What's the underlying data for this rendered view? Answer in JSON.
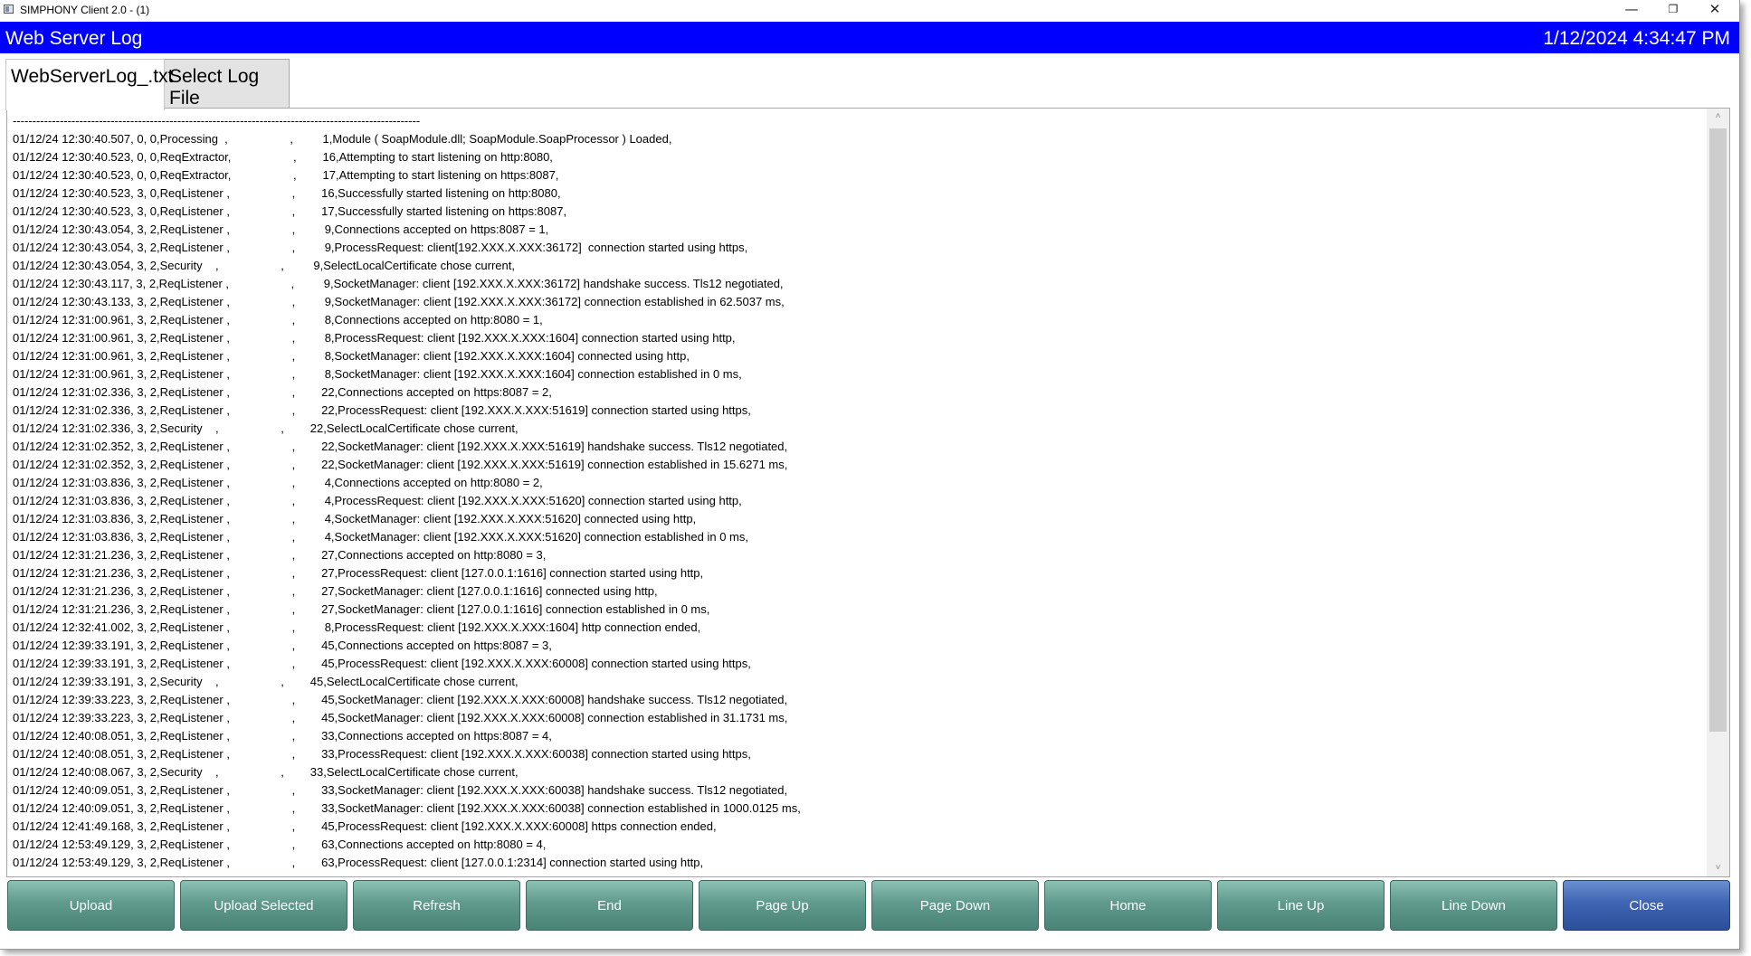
{
  "window": {
    "title": "SIMPHONY Client 2.0 - (1)",
    "controls": {
      "minimize": "—",
      "restore": "❐",
      "close": "✕"
    }
  },
  "header": {
    "title": "Web Server Log",
    "datetime": "1/12/2024 4:34:47 PM",
    "background": "#0000ff"
  },
  "tabs": [
    {
      "label": "WebServerLog_.txt",
      "active": true
    },
    {
      "label": "Select Log File",
      "active": false
    }
  ],
  "log": {
    "lines": [
      "--------------------------------------------------------------------------------------------------------",
      "01/12/24 12:30:40.507, 0, 0,Processing  ,                   ,         1,Module ( SoapModule.dll; SoapModule.SoapProcessor ) Loaded,",
      "01/12/24 12:30:40.523, 0, 0,ReqExtractor,                   ,        16,Attempting to start listening on http:8080,",
      "01/12/24 12:30:40.523, 0, 0,ReqExtractor,                   ,        17,Attempting to start listening on https:8087,",
      "01/12/24 12:30:40.523, 3, 0,ReqListener ,                   ,        16,Successfully started listening on http:8080,",
      "01/12/24 12:30:40.523, 3, 0,ReqListener ,                   ,        17,Successfully started listening on https:8087,",
      "01/12/24 12:30:43.054, 3, 2,ReqListener ,                   ,         9,Connections accepted on https:8087 = 1,",
      "01/12/24 12:30:43.054, 3, 2,ReqListener ,                   ,         9,ProcessRequest: client[192.XXX.X.XXX:36172]  connection started using https,",
      "01/12/24 12:30:43.054, 3, 2,Security    ,                   ,         9,SelectLocalCertificate chose current,",
      "01/12/24 12:30:43.117, 3, 2,ReqListener ,                   ,         9,SocketManager: client [192.XXX.X.XXX:36172] handshake success. Tls12 negotiated,",
      "01/12/24 12:30:43.133, 3, 2,ReqListener ,                   ,         9,SocketManager: client [192.XXX.X.XXX:36172] connection established in 62.5037 ms,",
      "01/12/24 12:31:00.961, 3, 2,ReqListener ,                   ,         8,Connections accepted on http:8080 = 1,",
      "01/12/24 12:31:00.961, 3, 2,ReqListener ,                   ,         8,ProcessRequest: client [192.XXX.X.XXX:1604] connection started using http,",
      "01/12/24 12:31:00.961, 3, 2,ReqListener ,                   ,         8,SocketManager: client [192.XXX.X.XXX:1604] connected using http,",
      "01/12/24 12:31:00.961, 3, 2,ReqListener ,                   ,         8,SocketManager: client [192.XXX.X.XXX:1604] connection established in 0 ms,",
      "01/12/24 12:31:02.336, 3, 2,ReqListener ,                   ,        22,Connections accepted on https:8087 = 2,",
      "01/12/24 12:31:02.336, 3, 2,ReqListener ,                   ,        22,ProcessRequest: client [192.XXX.X.XXX:51619] connection started using https,",
      "01/12/24 12:31:02.336, 3, 2,Security    ,                   ,        22,SelectLocalCertificate chose current,",
      "01/12/24 12:31:02.352, 3, 2,ReqListener ,                   ,        22,SocketManager: client [192.XXX.X.XXX:51619] handshake success. Tls12 negotiated,",
      "01/12/24 12:31:02.352, 3, 2,ReqListener ,                   ,        22,SocketManager: client [192.XXX.X.XXX:51619] connection established in 15.6271 ms,",
      "01/12/24 12:31:03.836, 3, 2,ReqListener ,                   ,         4,Connections accepted on http:8080 = 2,",
      "01/12/24 12:31:03.836, 3, 2,ReqListener ,                   ,         4,ProcessRequest: client [192.XXX.X.XXX:51620] connection started using http,",
      "01/12/24 12:31:03.836, 3, 2,ReqListener ,                   ,         4,SocketManager: client [192.XXX.X.XXX:51620] connected using http,",
      "01/12/24 12:31:03.836, 3, 2,ReqListener ,                   ,         4,SocketManager: client [192.XXX.X.XXX:51620] connection established in 0 ms,",
      "01/12/24 12:31:21.236, 3, 2,ReqListener ,                   ,        27,Connections accepted on http:8080 = 3,",
      "01/12/24 12:31:21.236, 3, 2,ReqListener ,                   ,        27,ProcessRequest: client [127.0.0.1:1616] connection started using http,",
      "01/12/24 12:31:21.236, 3, 2,ReqListener ,                   ,        27,SocketManager: client [127.0.0.1:1616] connected using http,",
      "01/12/24 12:31:21.236, 3, 2,ReqListener ,                   ,        27,SocketManager: client [127.0.0.1:1616] connection established in 0 ms,",
      "01/12/24 12:32:41.002, 3, 2,ReqListener ,                   ,         8,ProcessRequest: client [192.XXX.X.XXX:1604] http connection ended,",
      "01/12/24 12:39:33.191, 3, 2,ReqListener ,                   ,        45,Connections accepted on https:8087 = 3,",
      "01/12/24 12:39:33.191, 3, 2,ReqListener ,                   ,        45,ProcessRequest: client [192.XXX.X.XXX:60008] connection started using https,",
      "01/12/24 12:39:33.191, 3, 2,Security    ,                   ,        45,SelectLocalCertificate chose current,",
      "01/12/24 12:39:33.223, 3, 2,ReqListener ,                   ,        45,SocketManager: client [192.XXX.X.XXX:60008] handshake success. Tls12 negotiated,",
      "01/12/24 12:39:33.223, 3, 2,ReqListener ,                   ,        45,SocketManager: client [192.XXX.X.XXX:60008] connection established in 31.1731 ms,",
      "01/12/24 12:40:08.051, 3, 2,ReqListener ,                   ,        33,Connections accepted on https:8087 = 4,",
      "01/12/24 12:40:08.051, 3, 2,ReqListener ,                   ,        33,ProcessRequest: client [192.XXX.X.XXX:60038] connection started using https,",
      "01/12/24 12:40:08.067, 3, 2,Security    ,                   ,        33,SelectLocalCertificate chose current,",
      "01/12/24 12:40:09.051, 3, 2,ReqListener ,                   ,        33,SocketManager: client [192.XXX.X.XXX:60038] handshake success. Tls12 negotiated,",
      "01/12/24 12:40:09.051, 3, 2,ReqListener ,                   ,        33,SocketManager: client [192.XXX.X.XXX:60038] connection established in 1000.0125 ms,",
      "01/12/24 12:41:49.168, 3, 2,ReqListener ,                   ,        45,ProcessRequest: client [192.XXX.X.XXX:60008] https connection ended,",
      "01/12/24 12:53:49.129, 3, 2,ReqListener ,                   ,        63,Connections accepted on http:8080 = 4,",
      "01/12/24 12:53:49.129, 3, 2,ReqListener ,                   ,        63,ProcessRequest: client [127.0.0.1:2314] connection started using http,"
    ]
  },
  "buttons": [
    {
      "id": "upload",
      "label": "Upload"
    },
    {
      "id": "upload-selected",
      "label": "Upload Selected"
    },
    {
      "id": "refresh",
      "label": "Refresh"
    },
    {
      "id": "end",
      "label": "End"
    },
    {
      "id": "page-up",
      "label": "Page Up"
    },
    {
      "id": "page-down",
      "label": "Page Down"
    },
    {
      "id": "home",
      "label": "Home"
    },
    {
      "id": "line-up",
      "label": "Line Up"
    },
    {
      "id": "line-down",
      "label": "Line Down"
    },
    {
      "id": "close",
      "label": "Close"
    }
  ],
  "colors": {
    "button_green": "#5f9a8c",
    "button_blue": "#3e64b2"
  },
  "scrollbar": {
    "up_icon": "˄",
    "down_icon": "˅"
  }
}
